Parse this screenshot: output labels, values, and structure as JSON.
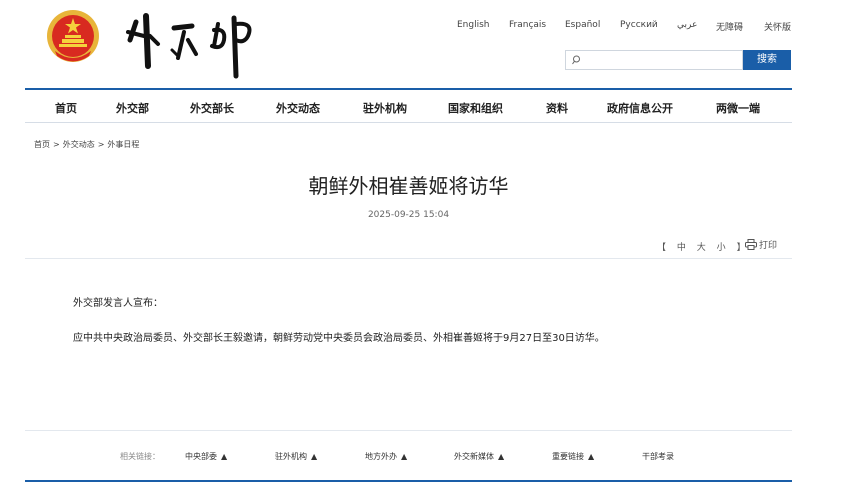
{
  "colors": {
    "brand_blue": "#1a5ea8",
    "emblem_red": "#d82a20",
    "emblem_gold": "#e8b53a"
  },
  "header": {
    "languages": [
      "English",
      "Français",
      "Español",
      "Русский",
      "عربي",
      "无障碍",
      "关怀版"
    ]
  },
  "search": {
    "value": "",
    "placeholder": "",
    "button_label": "搜索",
    "icon": "search-icon"
  },
  "nav": {
    "items": [
      "首页",
      "外交部",
      "外交部长",
      "外交动态",
      "驻外机构",
      "国家和组织",
      "资料",
      "政府信息公开",
      "两微一端"
    ]
  },
  "breadcrumb": {
    "items": [
      "首页",
      "外交动态",
      "外事日程"
    ],
    "separator": ">"
  },
  "article": {
    "title": "朝鲜外相崔善姬将访华",
    "date": "2025-09-25 15:04",
    "font_size_label_open": "【",
    "font_sizes": [
      "中",
      "大",
      "小"
    ],
    "font_size_label_close": "】",
    "print_label": "打印",
    "paragraphs": [
      "外交部发言人宣布：",
      "应中共中央政治局委员、外交部长王毅邀请，朝鲜劳动党中央委员会政治局委员、外相崔善姬将于9月27日至30日访华。"
    ]
  },
  "footer": {
    "label": "相关链接：",
    "links": [
      "中央部委",
      "驻外机构",
      "地方外办",
      "外交新媒体",
      "重要链接",
      "干部考录"
    ],
    "arrow": "▲"
  }
}
